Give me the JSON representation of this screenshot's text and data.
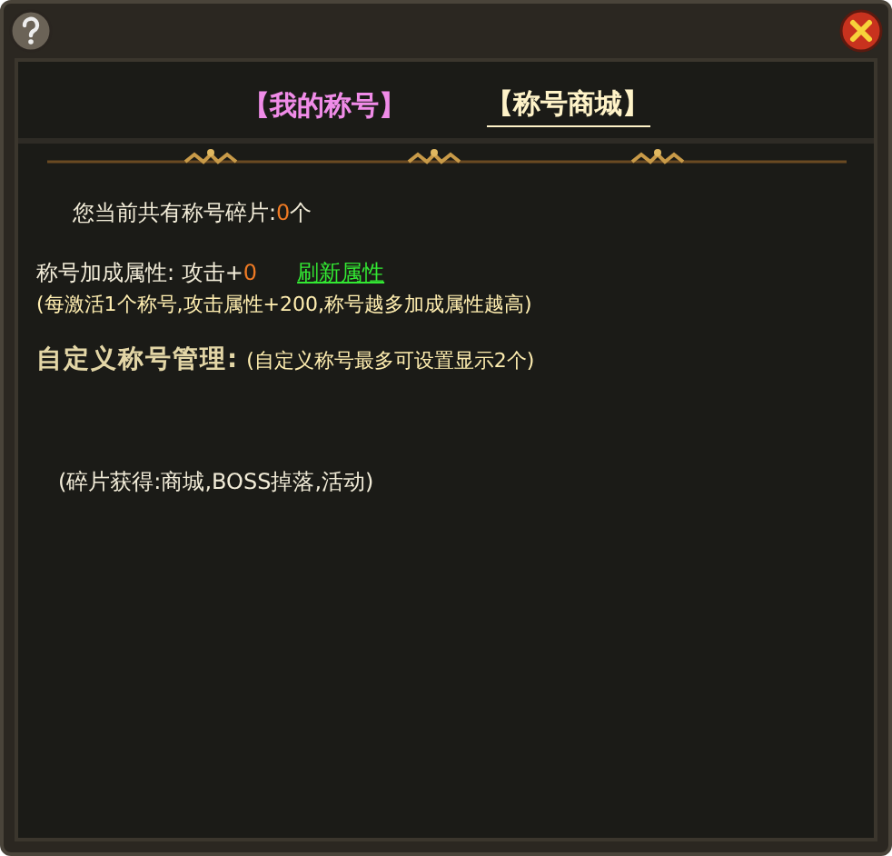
{
  "tabs": [
    {
      "label": "【我的称号】",
      "selected": true
    },
    {
      "label": "【称号商城】",
      "selected": false
    }
  ],
  "fragments": {
    "label": "您当前共有称号碎片:",
    "value": "0",
    "unit": "个"
  },
  "bonus": {
    "label": "称号加成属性: 攻击+",
    "value": "0",
    "action": "刷新属性",
    "note": "(每激活1个称号,攻击属性+200,称号越多加成属性越高)"
  },
  "custom": {
    "title": "自定义称号管理:",
    "note": "(自定义称号最多可设置显示2个)"
  },
  "source": "(碎片获得:商城,BOSS掉落,活动)"
}
